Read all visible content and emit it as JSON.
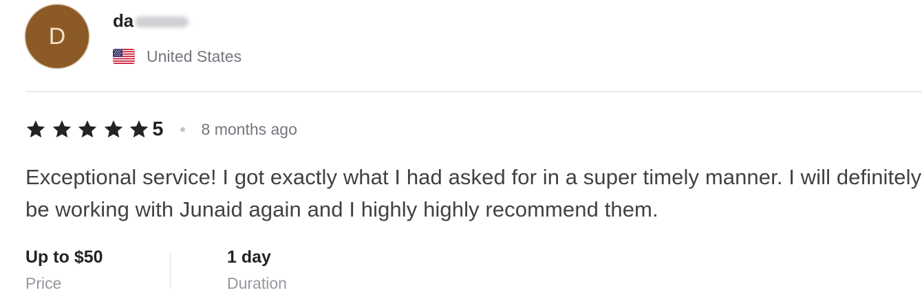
{
  "reviewer": {
    "avatar_initial": "D",
    "username_visible": "da",
    "country": "United States",
    "flag_icon": "us-flag-icon"
  },
  "rating": {
    "stars": 5,
    "value": "5",
    "time_ago": "8 months ago"
  },
  "review": {
    "text": "Exceptional service! I got exactly what I had asked for in a super timely manner. I will definitely be working with Junaid again and I highly highly recommend them."
  },
  "meta": {
    "price_value": "Up to $50",
    "price_label": "Price",
    "duration_value": "1 day",
    "duration_label": "Duration"
  },
  "colors": {
    "avatar_bg": "#8c5a26",
    "star": "#222325",
    "text": "#404145",
    "muted": "#74767e"
  }
}
